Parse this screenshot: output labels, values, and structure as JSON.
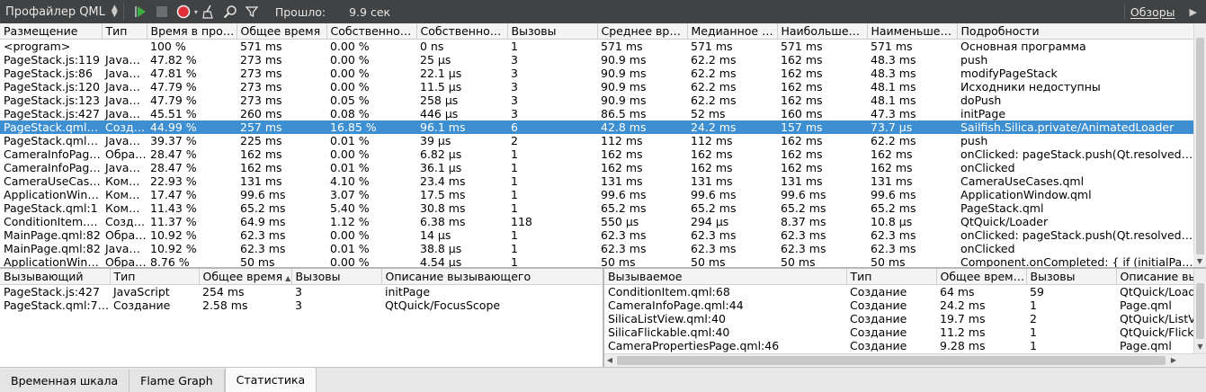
{
  "toolbar": {
    "title": "Профайлер QML",
    "elapsed_label": "Прошло:",
    "elapsed_value": "9.9 сек",
    "views_label": "Обзоры"
  },
  "main_table": {
    "headers": [
      "Размещение",
      "Тип",
      "Время в проц",
      "Общее время",
      "Собственное вр",
      "Собственное вр",
      "Вызовы",
      "Среднее время",
      "Медианное вре",
      "Наибольшее вр",
      "Наименьшее вр",
      "Подробности"
    ],
    "sort_column": 2,
    "selected_row": 6,
    "rows": [
      [
        "<program>",
        "",
        "100 %",
        "571 ms",
        "0.00 %",
        "0 ns",
        "1",
        "571 ms",
        "571 ms",
        "571 ms",
        "571 ms",
        "Основная программа"
      ],
      [
        "PageStack.js:119",
        "Java…",
        "47.82 %",
        "273 ms",
        "0.00 %",
        "25 µs",
        "3",
        "90.9 ms",
        "62.2 ms",
        "162 ms",
        "48.3 ms",
        "push"
      ],
      [
        "PageStack.js:86",
        "Java…",
        "47.81 %",
        "273 ms",
        "0.00 %",
        "22.1 µs",
        "3",
        "90.9 ms",
        "62.2 ms",
        "162 ms",
        "48.3 ms",
        "modifyPageStack"
      ],
      [
        "PageStack.js:120",
        "Java…",
        "47.79 %",
        "273 ms",
        "0.00 %",
        "11.5 µs",
        "3",
        "90.9 ms",
        "62.2 ms",
        "162 ms",
        "48.1 ms",
        "Исходники недоступны"
      ],
      [
        "PageStack.js:123",
        "Java…",
        "47.79 %",
        "273 ms",
        "0.05 %",
        "258 µs",
        "3",
        "90.9 ms",
        "62.2 ms",
        "162 ms",
        "48.1 ms",
        "doPush"
      ],
      [
        "PageStack.js:427",
        "Java…",
        "45.51 %",
        "260 ms",
        "0.08 %",
        "446 µs",
        "3",
        "86.5 ms",
        "52 ms",
        "160 ms",
        "47.3 ms",
        "initPage"
      ],
      [
        "PageStack.qml:…",
        "Созд…",
        "44.99 %",
        "257 ms",
        "16.85 %",
        "96.1 ms",
        "6",
        "42.8 ms",
        "24.2 ms",
        "157 ms",
        "73.7 µs",
        "Sailfish.Silica.private/AnimatedLoader"
      ],
      [
        "PageStack.qml:…",
        "Java…",
        "39.37 %",
        "225 ms",
        "0.01 %",
        "39 µs",
        "2",
        "112 ms",
        "112 ms",
        "162 ms",
        "62.2 ms",
        "push"
      ],
      [
        "CameraInfoPag…",
        "Обра…",
        "28.47 %",
        "162 ms",
        "0.00 %",
        "6.82 µs",
        "1",
        "162 ms",
        "162 ms",
        "162 ms",
        "162 ms",
        "onClicked: pageStack.push(Qt.resolved…"
      ],
      [
        "CameraInfoPag…",
        "Java…",
        "28.47 %",
        "162 ms",
        "0.01 %",
        "36.1 µs",
        "1",
        "162 ms",
        "162 ms",
        "162 ms",
        "162 ms",
        "onClicked"
      ],
      [
        "CameraUseCas…",
        "Ком…",
        "22.93 %",
        "131 ms",
        "4.10 %",
        "23.4 ms",
        "1",
        "131 ms",
        "131 ms",
        "131 ms",
        "131 ms",
        "CameraUseCases.qml"
      ],
      [
        "ApplicationWin…",
        "Ком…",
        "17.47 %",
        "99.6 ms",
        "3.07 %",
        "17.5 ms",
        "1",
        "99.6 ms",
        "99.6 ms",
        "99.6 ms",
        "99.6 ms",
        "ApplicationWindow.qml"
      ],
      [
        "PageStack.qml:1",
        "Ком…",
        "11.43 %",
        "65.2 ms",
        "5.40 %",
        "30.8 ms",
        "1",
        "65.2 ms",
        "65.2 ms",
        "65.2 ms",
        "65.2 ms",
        "PageStack.qml"
      ],
      [
        "ConditionItem.…",
        "Созд…",
        "11.37 %",
        "64.9 ms",
        "1.12 %",
        "6.38 ms",
        "118",
        "550 µs",
        "294 µs",
        "8.37 ms",
        "10.8 µs",
        "QtQuick/Loader"
      ],
      [
        "MainPage.qml:82",
        "Обра…",
        "10.92 %",
        "62.3 ms",
        "0.00 %",
        "14 µs",
        "1",
        "62.3 ms",
        "62.3 ms",
        "62.3 ms",
        "62.3 ms",
        "onClicked: pageStack.push(Qt.resolved…"
      ],
      [
        "MainPage.qml:82",
        "Java…",
        "10.92 %",
        "62.3 ms",
        "0.01 %",
        "38.8 µs",
        "1",
        "62.3 ms",
        "62.3 ms",
        "62.3 ms",
        "62.3 ms",
        "onClicked"
      ],
      [
        "ApplicationWin…",
        "Обра…",
        "8.76 %",
        "50 ms",
        "0.00 %",
        "4.54 µs",
        "1",
        "50 ms",
        "50 ms",
        "50 ms",
        "50 ms",
        "Component.onCompleted: { if (initialPag…"
      ]
    ]
  },
  "callers_table": {
    "headers": [
      "Вызывающий",
      "Тип",
      "Общее время",
      "Вызовы",
      "Описание вызывающего"
    ],
    "sort_column": 2,
    "rows": [
      [
        "PageStack.js:427",
        "JavaScript",
        "254 ms",
        "3",
        "initPage"
      ],
      [
        "PageStack.qml:744",
        "Создание",
        "2.58 ms",
        "3",
        "QtQuick/FocusScope"
      ]
    ]
  },
  "callees_table": {
    "headers": [
      "Вызываемое",
      "Тип",
      "Общее время",
      "Вызовы",
      "Описание вызываемого"
    ],
    "sort_column": 2,
    "rows": [
      [
        "ConditionItem.qml:68",
        "Создание",
        "64 ms",
        "59",
        "QtQuick/Loader"
      ],
      [
        "CameraInfoPage.qml:44",
        "Создание",
        "24.2 ms",
        "1",
        "Page.qml"
      ],
      [
        "SilicaListView.qml:40",
        "Создание",
        "19.7 ms",
        "2",
        "QtQuick/ListView"
      ],
      [
        "SilicaFlickable.qml:40",
        "Создание",
        "11.2 ms",
        "1",
        "QtQuick/Flick…"
      ],
      [
        "CameraPropertiesPage.qml:46",
        "Создание",
        "9.28 ms",
        "1",
        "Page.qml"
      ]
    ]
  },
  "tabs": [
    "Временная шкала",
    "Flame Graph",
    "Статистика"
  ],
  "active_tab": 2,
  "colors": {
    "toolbar_bg": "#404244",
    "selection": "#3d8fd1",
    "record_button": "#e0303a",
    "play_icon": "#3cb043"
  }
}
